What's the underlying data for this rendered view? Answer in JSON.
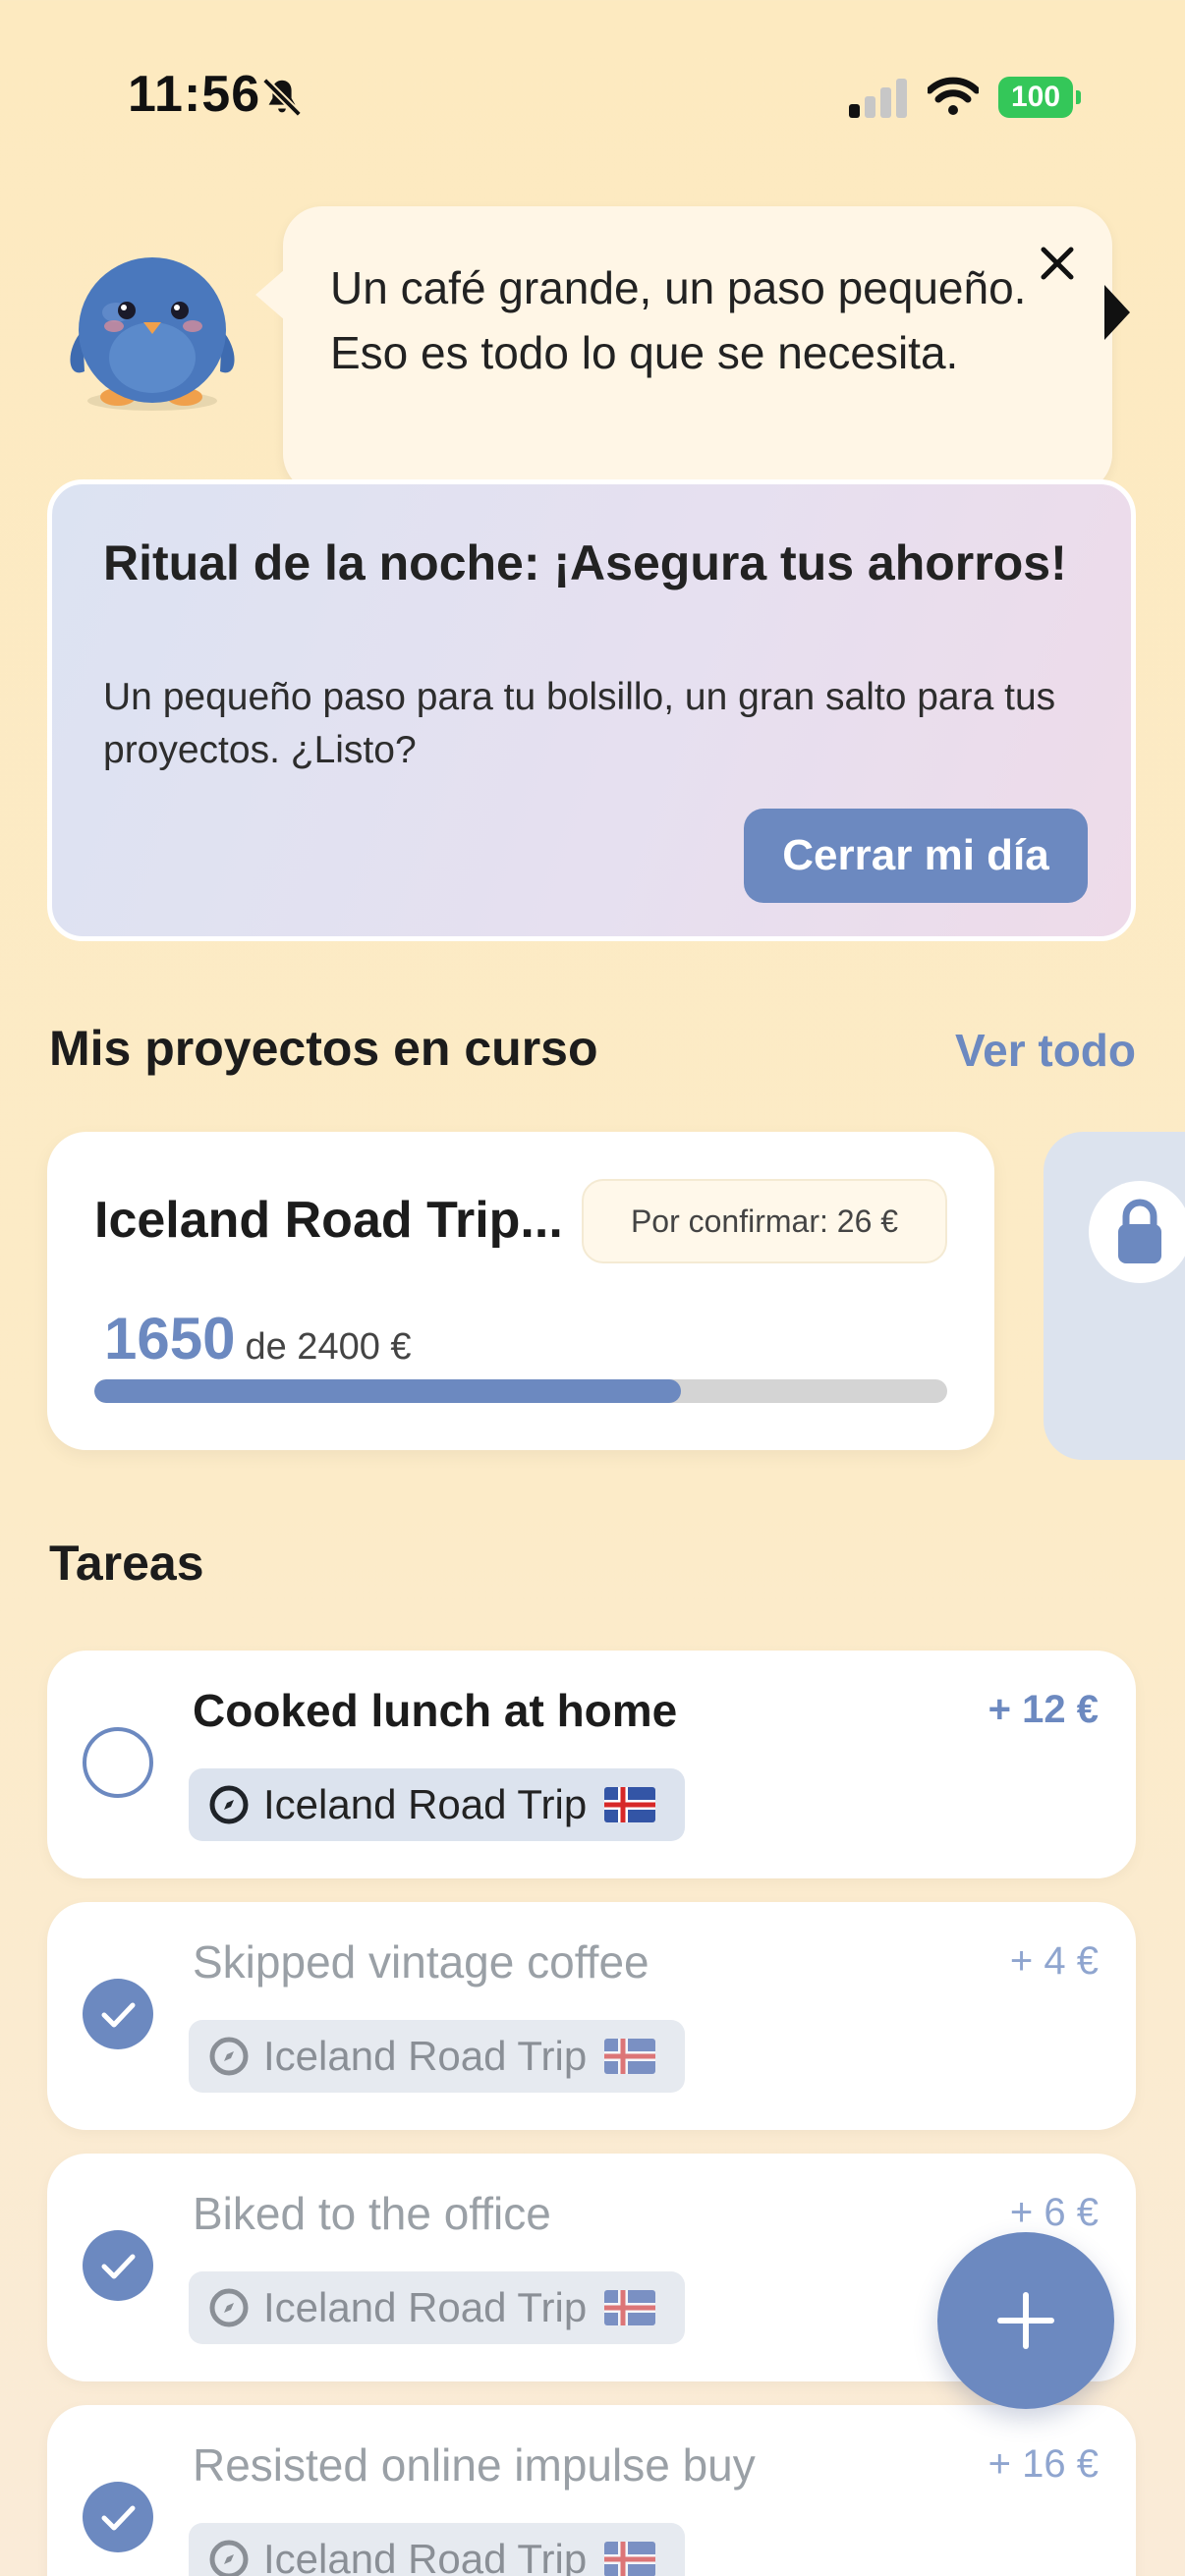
{
  "status_bar": {
    "time": "11:56",
    "battery": "100",
    "icons": [
      "bell-slash-icon",
      "signal-icon",
      "wifi-icon",
      "battery-icon"
    ]
  },
  "colors": {
    "accent": "#6C89C0",
    "background": "#FDEAC0",
    "battery": "#34C759"
  },
  "speech_bubble": {
    "text": "Un café grande, un paso pequeño. Eso es todo lo que se necesita."
  },
  "ritual_card": {
    "title": "Ritual de la noche: ¡Asegura tus ahorros!",
    "subtitle": "Un pequeño paso para tu bolsillo, un gran salto para tus proyectos. ¿Listo?",
    "button_label": "Cerrar mi día"
  },
  "projects": {
    "section_title": "Mis proyectos en curso",
    "see_all_label": "Ver todo",
    "items": [
      {
        "name": "Iceland Road Trip...",
        "pending_label": "Por confirmar: 26 €",
        "current": "1650",
        "total_label": "de 2400 €",
        "progress_fraction": 0.6875
      }
    ]
  },
  "tasks": {
    "section_title": "Tareas",
    "items": [
      {
        "title": "Cooked lunch at home",
        "amount": "+ 12 €",
        "tag": "Iceland Road Trip",
        "done": false
      },
      {
        "title": "Skipped vintage coffee",
        "amount": "+ 4 €",
        "tag": "Iceland Road Trip",
        "done": true
      },
      {
        "title": "Biked to the office",
        "amount": "+ 6 €",
        "tag": "Iceland Road Trip",
        "done": true
      },
      {
        "title": "Resisted online impulse buy",
        "amount": "+ 16 €",
        "tag": "Iceland Road Trip",
        "done": true
      }
    ]
  }
}
